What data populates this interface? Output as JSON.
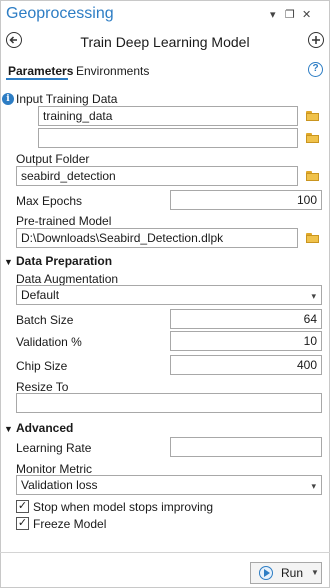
{
  "window": {
    "app_title": "Geoprocessing",
    "controls": [
      "▾",
      "❐",
      "✕"
    ]
  },
  "header": {
    "tool_title": "Train Deep Learning Model"
  },
  "tabs": [
    {
      "label": "Parameters",
      "active": true
    },
    {
      "label": "Environments",
      "active": false
    }
  ],
  "help_glyph": "?",
  "colors": {
    "accent": "#2d7dc4",
    "folder": "#f0c24b"
  },
  "fields": {
    "input_training_data": {
      "label": "Input Training Data",
      "values": [
        "training_data",
        ""
      ]
    },
    "output_folder": {
      "label": "Output Folder",
      "value": "seabird_detection"
    },
    "max_epochs": {
      "label": "Max Epochs",
      "value": "100"
    },
    "pretrained_model": {
      "label": "Pre-trained Model",
      "value": "D:\\Downloads\\Seabird_Detection.dlpk"
    }
  },
  "data_preparation": {
    "title": "Data Preparation",
    "data_augmentation": {
      "label": "Data Augmentation",
      "value": "Default"
    },
    "batch_size": {
      "label": "Batch Size",
      "value": "64"
    },
    "validation": {
      "label": "Validation %",
      "value": "10"
    },
    "chip_size": {
      "label": "Chip Size",
      "value": "400"
    },
    "resize_to": {
      "label": "Resize To",
      "value": ""
    }
  },
  "advanced": {
    "title": "Advanced",
    "learning_rate": {
      "label": "Learning Rate",
      "value": ""
    },
    "monitor_metric": {
      "label": "Monitor Metric",
      "value": "Validation loss"
    },
    "stop_improving": {
      "label": "Stop when model stops improving",
      "checked": true
    },
    "freeze_model": {
      "label": "Freeze Model",
      "checked": true
    }
  },
  "footer": {
    "run_label": "Run"
  }
}
